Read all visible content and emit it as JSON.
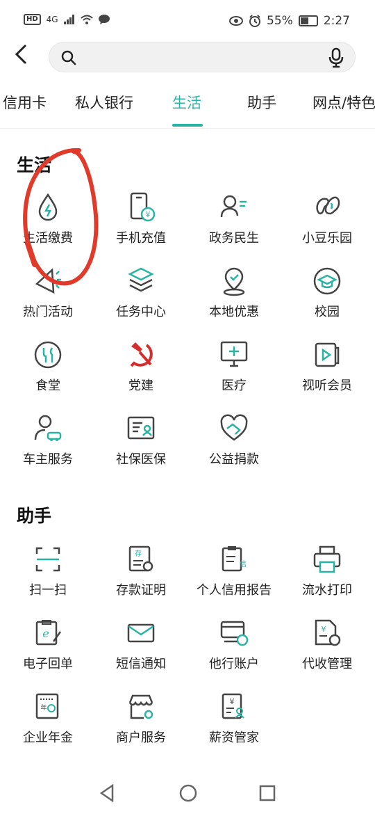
{
  "status": {
    "network": "4G",
    "battery": "55%",
    "time": "2:27",
    "hd": "HD"
  },
  "search": {
    "placeholder": ""
  },
  "tabs": [
    {
      "label": "信用卡"
    },
    {
      "label": "私人银行"
    },
    {
      "label": "生活"
    },
    {
      "label": "助手"
    },
    {
      "label": "网点/特色"
    }
  ],
  "life": {
    "title": "生活",
    "items": [
      {
        "label": "生活缴费"
      },
      {
        "label": "手机充值"
      },
      {
        "label": "政务民生"
      },
      {
        "label": "小豆乐园"
      },
      {
        "label": "热门活动"
      },
      {
        "label": "任务中心"
      },
      {
        "label": "本地优惠"
      },
      {
        "label": "校园"
      },
      {
        "label": "食堂"
      },
      {
        "label": "党建"
      },
      {
        "label": "医疗"
      },
      {
        "label": "视听会员"
      },
      {
        "label": "车主服务"
      },
      {
        "label": "社保医保"
      },
      {
        "label": "公益捐款"
      }
    ]
  },
  "helper": {
    "title": "助手",
    "items": [
      {
        "label": "扫一扫"
      },
      {
        "label": "存款证明"
      },
      {
        "label": "个人信用报告"
      },
      {
        "label": "流水打印"
      },
      {
        "label": "电子回单"
      },
      {
        "label": "短信通知"
      },
      {
        "label": "他行账户"
      },
      {
        "label": "代收管理"
      },
      {
        "label": "企业年金"
      },
      {
        "label": "商户服务"
      },
      {
        "label": "薪资管家"
      }
    ]
  },
  "colors": {
    "accent": "#2ab3a3",
    "icon": "#444444",
    "annotation": "#e03a2a",
    "party": "#d32f2f"
  }
}
